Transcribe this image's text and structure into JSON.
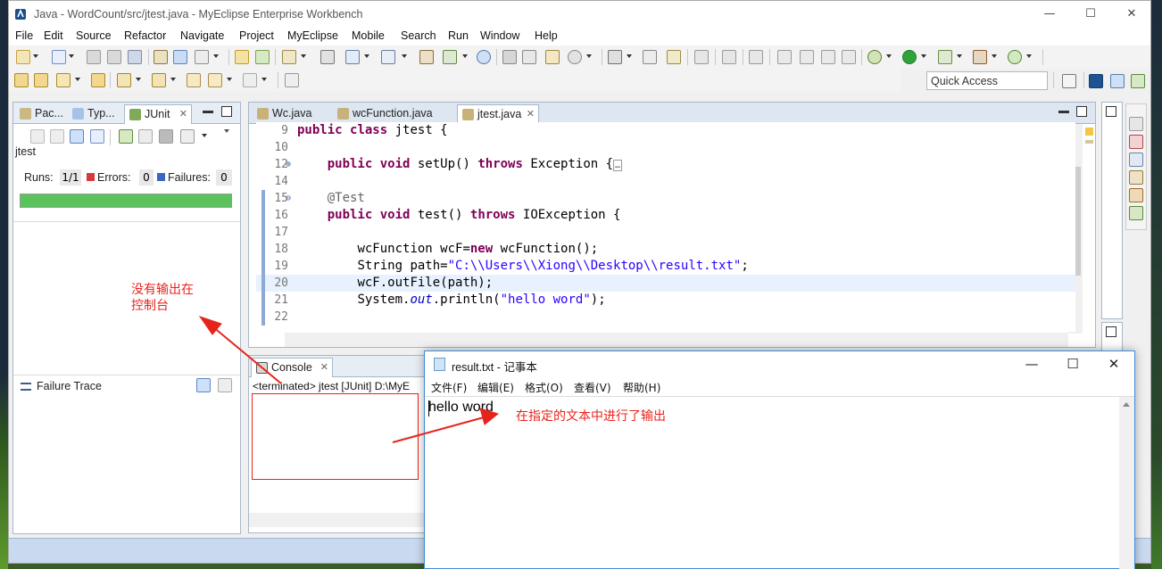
{
  "window": {
    "title": "Java - WordCount/src/jtest.java - MyEclipse Enterprise Workbench",
    "minimize": "—",
    "maximize": "☐",
    "close": "✕"
  },
  "menubar": [
    "File",
    "Edit",
    "Source",
    "Refactor",
    "Navigate",
    "Project",
    "MyEclipse",
    "Mobile",
    "Search",
    "Run",
    "Window",
    "Help"
  ],
  "quick_access": "Quick Access",
  "left_panel": {
    "tabs": [
      {
        "label": "Pac...",
        "icon": "package-icon"
      },
      {
        "label": "Typ...",
        "icon": "hierarchy-icon"
      },
      {
        "label": "JUnit",
        "icon": "junit-icon"
      }
    ],
    "test_name": "jtest",
    "runs_label": "Runs:",
    "runs_value": "1/1",
    "errors_label": "Errors:",
    "errors_value": "0",
    "failures_label": "Failures:",
    "failures_value": "0",
    "progress_fraction": 1.0,
    "failure_trace_label": "Failure Trace"
  },
  "editor": {
    "tabs": [
      {
        "label": "Wc.java"
      },
      {
        "label": "wcFunction.java"
      },
      {
        "label": "jtest.java",
        "active": true
      }
    ],
    "lines": [
      {
        "n": "9"
      },
      {
        "n": "10"
      },
      {
        "n": "12"
      },
      {
        "n": "14"
      },
      {
        "n": "15"
      },
      {
        "n": "16"
      },
      {
        "n": "17"
      },
      {
        "n": "18"
      },
      {
        "n": "19"
      },
      {
        "n": "20"
      },
      {
        "n": "21"
      },
      {
        "n": "22"
      }
    ],
    "code": {
      "l9_kw1": "public",
      "l9_kw2": "class",
      "l9_rest": " jtest {",
      "l12_kw1": "public",
      "l12_kw2": "void",
      "l12_mid": " setUp() ",
      "l12_kw3": "throws",
      "l12_rest": " Exception {",
      "l12_folded": "…",
      "l15_ann": "@Test",
      "l16_kw1": "public",
      "l16_kw2": "void",
      "l16_mid": " test() ",
      "l16_kw3": "throws",
      "l16_rest": " IOException {",
      "l18_a": "wcFunction wcF=",
      "l18_kw": "new",
      "l18_b": " wcFunction();",
      "l19_a": "String path=",
      "l19_str": "\"C:\\\\Users\\\\Xiong\\\\Desktop\\\\result.txt\"",
      "l19_b": ";",
      "l20": "wcF.outFile(path);",
      "l21_a": "System.",
      "l21_out": "out",
      "l21_b": ".println(",
      "l21_str": "\"hello word\"",
      "l21_c": ");"
    }
  },
  "console": {
    "tab_label": "Console",
    "status_line": "<terminated> jtest [JUnit] D:\\MyE"
  },
  "notepad": {
    "title": "result.txt - 记事本",
    "minimize": "—",
    "maximize": "☐",
    "close": "✕",
    "menu": [
      "文件(F)",
      "编辑(E)",
      "格式(O)",
      "查看(V)",
      "帮助(H)"
    ],
    "content": "hello word"
  },
  "annotations": {
    "no_output_line1": "没有输出在",
    "no_output_line2": "控制台",
    "output_in_file": "在指定的文本中进行了输出",
    "color": "#e8231c"
  }
}
